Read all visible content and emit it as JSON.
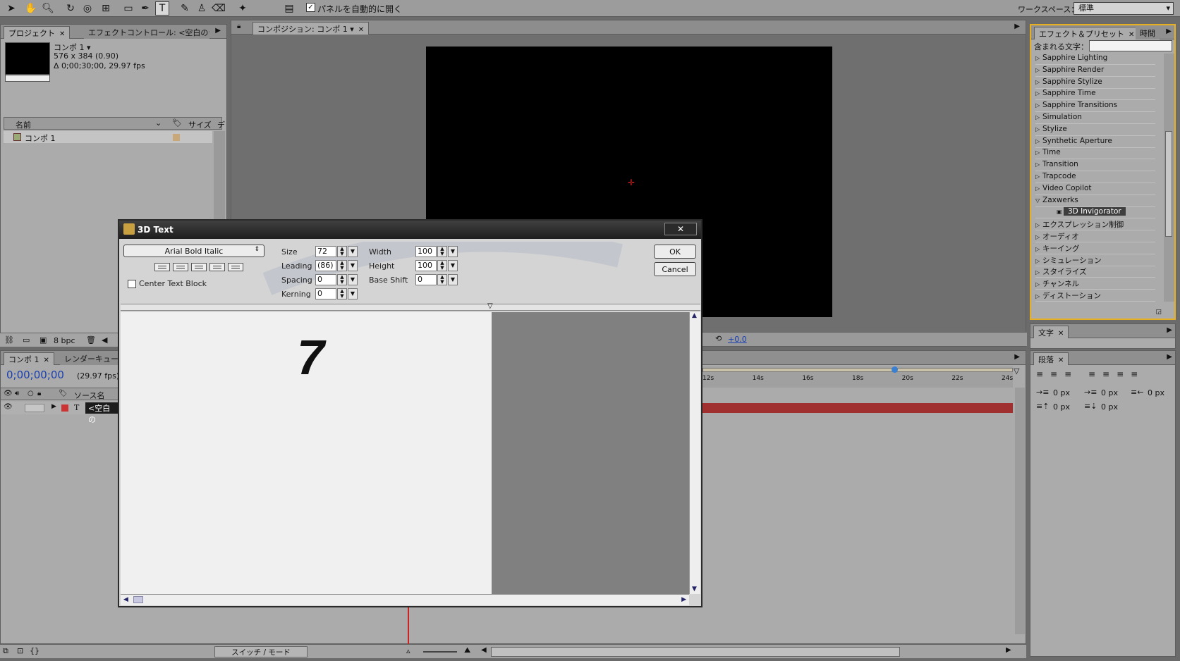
{
  "toolbar": {
    "auto_open_panels_label": "パネルを自動的に開く",
    "workspace_label": "ワークスペース：",
    "workspace_value": "標準"
  },
  "project_panel": {
    "tab_project": "プロジェクト",
    "tab_effect_controls": "エフェクトコントロール: <空白のテキ",
    "comp_name": "コンポ 1 ▾",
    "comp_dims": "576 x 384 (0.90)",
    "comp_duration": "Δ 0;00;30;00, 29.97 fps",
    "col_name": "名前",
    "col_size": "サイズ",
    "col_extra": "デ",
    "item_name": "コンポ 1",
    "bit_depth": "8 bpc"
  },
  "composition_panel": {
    "tab_label": "コンポジション: コンポ 1",
    "exposure": "+0.0"
  },
  "effects_panel": {
    "tab_effects": "エフェクト＆プリセット",
    "tab_time": "時間",
    "search_label": "含まれる文字：",
    "search_value": "",
    "items": [
      {
        "label": "Sapphire Lighting",
        "state": "collapsed"
      },
      {
        "label": "Sapphire Render",
        "state": "collapsed"
      },
      {
        "label": "Sapphire Stylize",
        "state": "collapsed"
      },
      {
        "label": "Sapphire Time",
        "state": "collapsed"
      },
      {
        "label": "Sapphire Transitions",
        "state": "collapsed"
      },
      {
        "label": "Simulation",
        "state": "collapsed"
      },
      {
        "label": "Stylize",
        "state": "collapsed"
      },
      {
        "label": "Synthetic Aperture",
        "state": "collapsed"
      },
      {
        "label": "Time",
        "state": "collapsed"
      },
      {
        "label": "Transition",
        "state": "collapsed"
      },
      {
        "label": "Trapcode",
        "state": "collapsed"
      },
      {
        "label": "Video Copilot",
        "state": "collapsed"
      },
      {
        "label": "Zaxwerks",
        "state": "expanded"
      },
      {
        "label": "3D Invigorator",
        "state": "child-selected"
      },
      {
        "label": "エクスプレッション制御",
        "state": "collapsed"
      },
      {
        "label": "オーディオ",
        "state": "collapsed"
      },
      {
        "label": "キーイング",
        "state": "collapsed"
      },
      {
        "label": "シミュレーション",
        "state": "collapsed"
      },
      {
        "label": "スタイライズ",
        "state": "collapsed"
      },
      {
        "label": "チャンネル",
        "state": "collapsed"
      },
      {
        "label": "ディストーション",
        "state": "collapsed"
      }
    ]
  },
  "character_panel": {
    "tab_label": "文字"
  },
  "paragraph_panel": {
    "tab_label": "段落",
    "indent_left": "0 px",
    "indent_first": "0 px",
    "indent_right": "0 px",
    "space_before": "0 px",
    "space_after": "0 px"
  },
  "timeline_panel": {
    "tab_comp": "コンポ 1",
    "tab_render": "レンダーキュー",
    "timecode": "0;00;00;00",
    "fps": "(29.97 fps)",
    "col_source": "ソース名",
    "layer_type": "T",
    "layer_name": "<空白の",
    "ruler_ticks": [
      "12s",
      "14s",
      "16s",
      "18s",
      "20s",
      "22s",
      "24s"
    ],
    "switch_mode": "スイッチ / モード"
  },
  "dialog": {
    "title": "3D Text",
    "close": "✕",
    "font_value": "Arial Bold Italic",
    "center_text_block": "Center Text Block",
    "size_label": "Size",
    "size_value": "72",
    "leading_label": "Leading",
    "leading_value": "(86)",
    "spacing_label": "Spacing",
    "spacing_value": "0",
    "kerning_label": "Kerning",
    "kerning_value": "0",
    "width_label": "Width",
    "width_value": "100",
    "height_label": "Height",
    "height_value": "100",
    "baseshift_label": "Base Shift",
    "baseshift_value": "0",
    "ok": "OK",
    "cancel": "Cancel",
    "preview_text": "7"
  },
  "colors": {
    "accent_yellow": "#e8b020",
    "timecode_blue": "#1a3fb0",
    "layer_bar_red": "#a03030"
  }
}
